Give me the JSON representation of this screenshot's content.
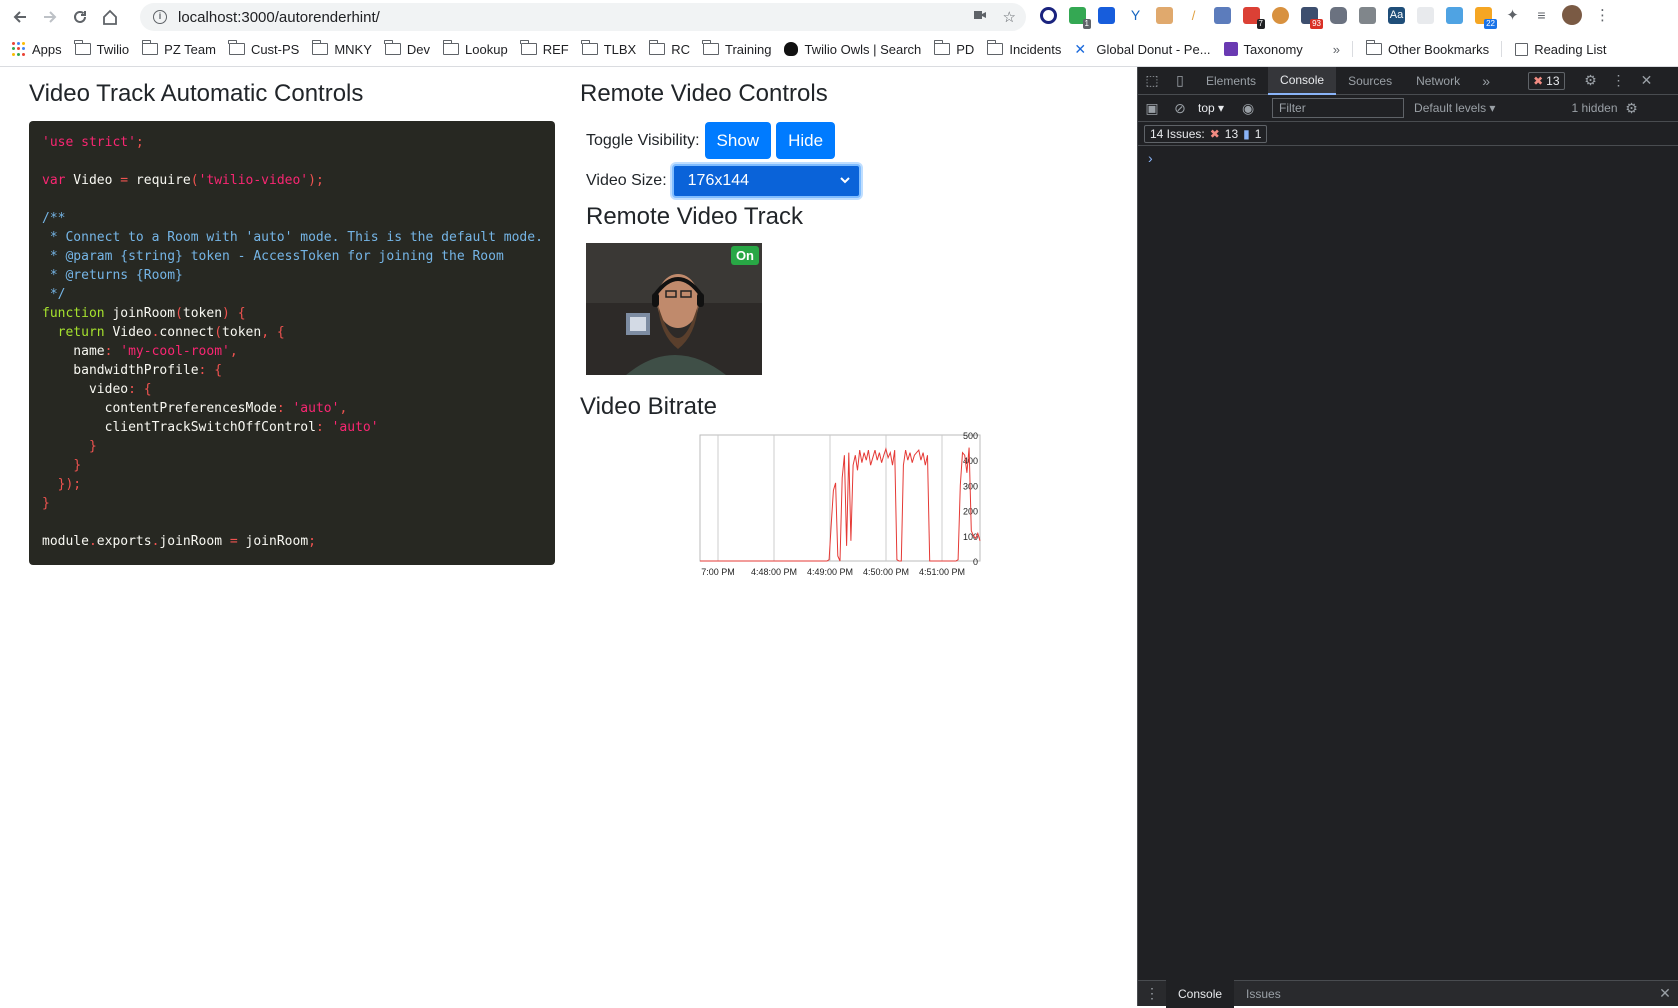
{
  "browser": {
    "url": "localhost:3000/autorenderhint/",
    "bookmarks": [
      "Apps",
      "Twilio",
      "PZ Team",
      "Cust-PS",
      "MNKY",
      "Dev",
      "Lookup",
      "REF",
      "TLBX",
      "RC",
      "Training",
      "Twilio Owls | Search",
      "PD",
      "Incidents",
      "Global Donut - Pe...",
      "Taxonomy"
    ],
    "other_bookmarks": "Other Bookmarks",
    "reading_list": "Reading List",
    "more": "»",
    "extension_badges": [
      "1",
      "7",
      "93",
      "22"
    ]
  },
  "left": {
    "title": "Video Track Automatic Controls"
  },
  "right": {
    "title": "Remote Video Controls",
    "toggle_label": "Toggle Visibility:",
    "show_label": "Show",
    "hide_label": "Hide",
    "size_label": "Video Size:",
    "size_value": "176x144",
    "track_title": "Remote Video Track",
    "video_badge": "On",
    "bitrate_title": "Video Bitrate"
  },
  "chart_data": {
    "type": "line",
    "title": "",
    "xlabel": "",
    "ylabel": "",
    "ylim": [
      0,
      500
    ],
    "y_ticks": [
      "500",
      "400",
      "300",
      "200",
      "100",
      "0"
    ],
    "x_ticks": [
      "7:00 PM",
      "4:48:00 PM",
      "4:49:00 PM",
      "4:50:00 PM",
      "4:51:00 PM"
    ],
    "grid": true,
    "color": "#e53935",
    "series": [
      {
        "values": [
          0,
          0,
          0,
          0,
          0,
          0,
          0,
          0,
          0,
          0,
          0,
          0,
          0,
          0,
          0,
          0,
          0,
          0,
          0,
          0,
          0,
          0,
          0,
          0,
          0,
          0,
          0,
          0,
          0,
          0,
          0,
          0,
          0,
          0,
          0,
          0,
          0,
          0,
          0,
          0,
          0,
          0,
          0,
          0,
          0,
          0,
          0,
          0,
          0,
          0,
          0,
          0,
          0,
          0,
          0,
          0,
          0,
          0,
          0,
          5,
          150,
          280,
          310,
          20,
          0,
          330,
          420,
          60,
          430,
          80,
          380,
          420,
          360,
          440,
          390,
          430,
          400,
          440,
          380,
          410,
          440,
          400,
          430,
          390,
          420,
          445,
          410,
          430,
          380,
          440,
          5,
          0,
          0,
          380,
          440,
          400,
          430,
          390,
          420,
          430,
          440,
          400,
          430,
          380,
          420,
          0,
          0,
          0,
          0,
          0,
          0,
          0,
          0,
          0,
          0,
          0,
          0,
          0,
          5,
          300,
          430,
          420,
          350,
          450,
          120,
          100,
          90,
          110,
          80
        ]
      }
    ]
  }
}
